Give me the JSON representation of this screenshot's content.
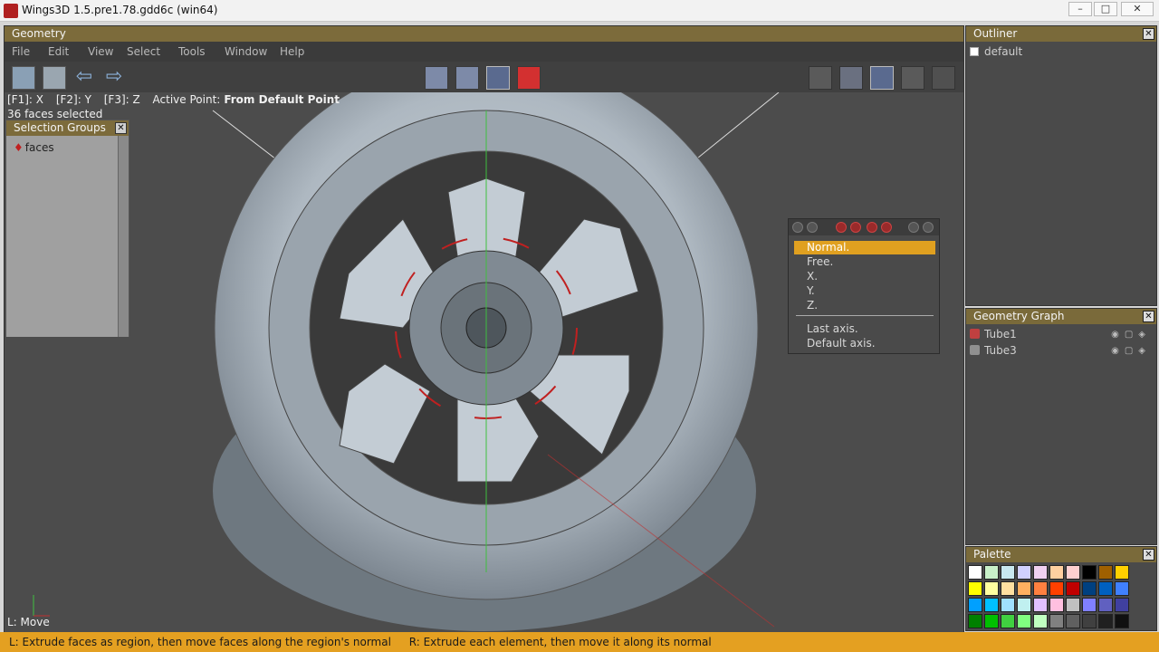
{
  "window": {
    "title": "Wings3D 1.5.pre1.78.gdd6c (win64)",
    "min": "–",
    "max": "□",
    "close": "✕"
  },
  "geometry": {
    "title": "Geometry",
    "menu": [
      "File",
      "Edit",
      "View",
      "Select",
      "Tools",
      "Window",
      "Help"
    ],
    "info": {
      "f1": "[F1]: X",
      "f2": "[F2]: Y",
      "f3": "[F3]: Z",
      "active_point_label": "Active Point:",
      "active_point_value": "From Default Point"
    },
    "selection_status": "36 faces selected",
    "lmb_hint": "L: Move"
  },
  "selection_groups": {
    "title": "Selection Groups",
    "items": [
      "faces"
    ],
    "close": "✕"
  },
  "popup": {
    "items": [
      "Normal.",
      "Free.",
      "X.",
      "Y.",
      "Z.",
      "Last axis.",
      "Default axis."
    ]
  },
  "outliner": {
    "title": "Outliner",
    "items": [
      "default"
    ],
    "close": "✕"
  },
  "geometry_graph": {
    "title": "Geometry Graph",
    "items": [
      "Tube1",
      "Tube3"
    ],
    "close": "✕"
  },
  "palette": {
    "title": "Palette",
    "close": "✕",
    "colors": [
      "#ffffff",
      "#c8f0c8",
      "#c8e8f0",
      "#d0d0ff",
      "#f0d0f0",
      "#ffd0a0",
      "#ffd0d0",
      "#000000",
      "#a06000",
      "#ffd000",
      "#ffff00",
      "#ffffa0",
      "#ffe0a0",
      "#ffb060",
      "#ff8040",
      "#ff4000",
      "#c00000",
      "#004080",
      "#0060c0",
      "#4080ff",
      "#00a0ff",
      "#00c0ff",
      "#a0e0ff",
      "#c0f0f0",
      "#e0c0ff",
      "#ffc0e0",
      "#c0c0c0",
      "#8080ff",
      "#6060c0",
      "#4040a0",
      "#008000",
      "#00c000",
      "#40d040",
      "#80ff80",
      "#c0ffc0",
      "#808080",
      "#606060",
      "#404040",
      "#202020",
      "#101010"
    ]
  },
  "status_bar": {
    "left": "L: Extrude faces as region, then move faces along the region's normal",
    "right": "R: Extrude each element, then move it along its normal"
  }
}
